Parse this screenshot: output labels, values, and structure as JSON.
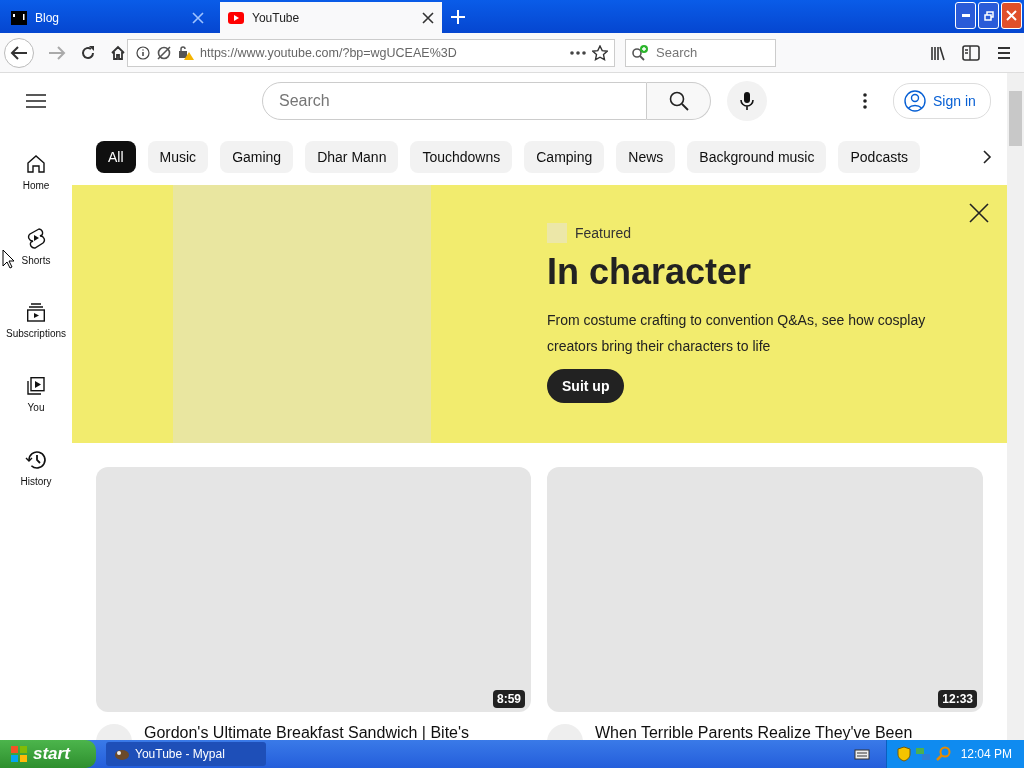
{
  "browser": {
    "tabs": [
      {
        "title": "Blog",
        "selected": false
      },
      {
        "title": "YouTube",
        "selected": true
      }
    ],
    "url": "https://www.youtube.com/?bp=wgUCEAE%3D",
    "search": {
      "placeholder": "Search"
    }
  },
  "page": {
    "search": {
      "placeholder": "Search"
    },
    "sign_in": "Sign in",
    "sidebar": [
      {
        "label": "Home"
      },
      {
        "label": "Shorts"
      },
      {
        "label": "Subscriptions"
      },
      {
        "label": "You"
      },
      {
        "label": "History"
      }
    ],
    "chips": [
      {
        "label": "All",
        "selected": true
      },
      {
        "label": "Music",
        "selected": false
      },
      {
        "label": "Gaming",
        "selected": false
      },
      {
        "label": "Dhar Mann",
        "selected": false
      },
      {
        "label": "Touchdowns",
        "selected": false
      },
      {
        "label": "Camping",
        "selected": false
      },
      {
        "label": "News",
        "selected": false
      },
      {
        "label": "Background music",
        "selected": false
      },
      {
        "label": "Podcasts",
        "selected": false
      }
    ],
    "banner": {
      "label": "Featured",
      "title": "In character",
      "description": "From costume crafting to convention Q&As, see how cosplay creators bring their characters to life",
      "button": "Suit up"
    },
    "videos": [
      {
        "duration": "8:59",
        "title": "Gordon's Ultimate Breakfast Sandwich | Bite's"
      },
      {
        "duration": "12:33",
        "title": "When Terrible Parents Realize They've Been"
      }
    ]
  },
  "taskbar": {
    "start": "start",
    "windows": [
      {
        "title": "YouTube - Mypal",
        "selected": true
      }
    ],
    "clock": "12:04 PM"
  }
}
